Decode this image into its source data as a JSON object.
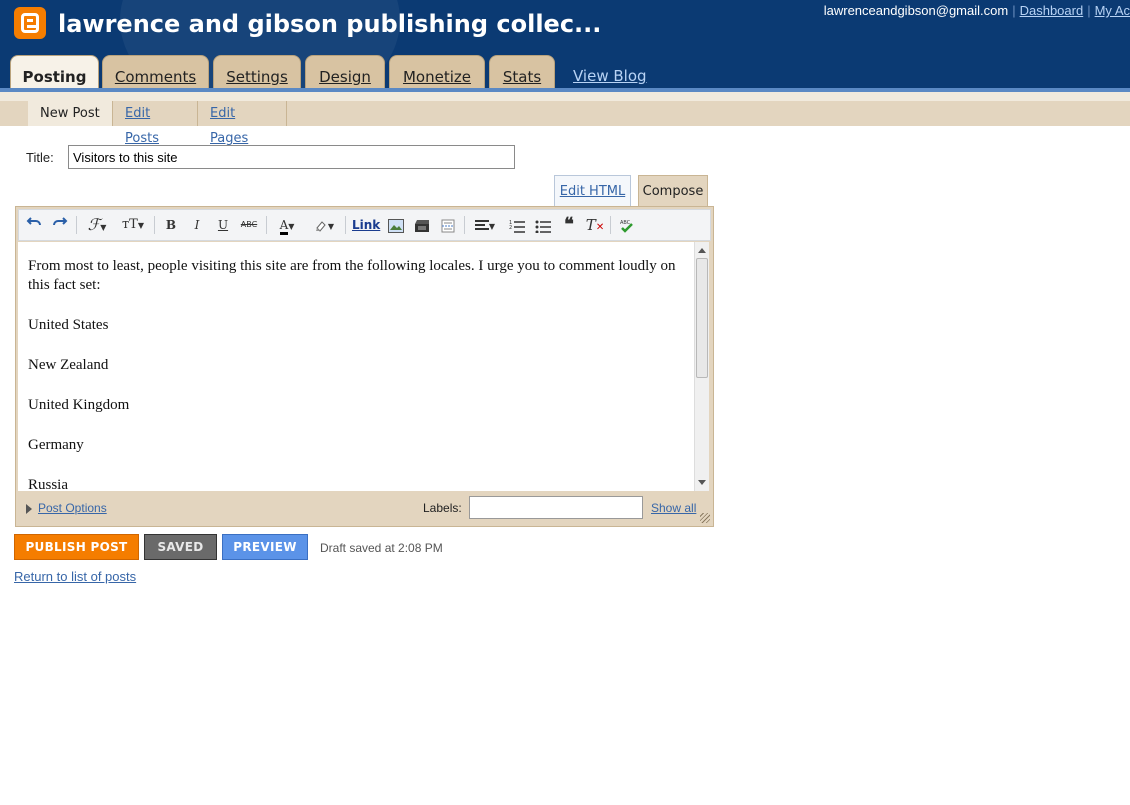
{
  "header": {
    "blog_title": "lawrence and gibson publishing collec...",
    "user_email": "lawrenceandgibson@gmail.com",
    "dashboard_link": "Dashboard",
    "account_link": "My Ac"
  },
  "tabs": [
    {
      "label": "Posting",
      "active": true
    },
    {
      "label": "Comments"
    },
    {
      "label": "Settings"
    },
    {
      "label": "Design"
    },
    {
      "label": "Monetize"
    },
    {
      "label": "Stats"
    }
  ],
  "view_blog": "View Blog",
  "subtabs": [
    "New Post",
    "Edit Posts",
    "Edit Pages"
  ],
  "title": {
    "label": "Title:",
    "value": "Visitors to this site"
  },
  "mode_tabs": {
    "edit_html": "Edit HTML",
    "compose": "Compose"
  },
  "toolbar": {
    "link": "Link",
    "font_size": "тТ"
  },
  "body": {
    "paragraphs": [
      "From most to least, people visiting this site are from the following locales. I urge you to comment loudly on this fact set:",
      "United States",
      "New Zealand",
      "United Kingdom",
      "Germany",
      "Russia"
    ]
  },
  "footer": {
    "post_options": "Post Options",
    "labels_label": "Labels:",
    "labels_value": "",
    "show_all": "Show all"
  },
  "actions": {
    "publish": "PUBLISH POST",
    "saved": "SAVED",
    "preview": "PREVIEW",
    "draft_status": "Draft saved at 2:08 PM"
  },
  "return_link": "Return to list of posts",
  "colors": {
    "header_bg": "#0b3a73",
    "tab_bg": "#d8c3a2",
    "publish": "#f57d00",
    "preview": "#5b93e8",
    "link": "#3766a8"
  }
}
